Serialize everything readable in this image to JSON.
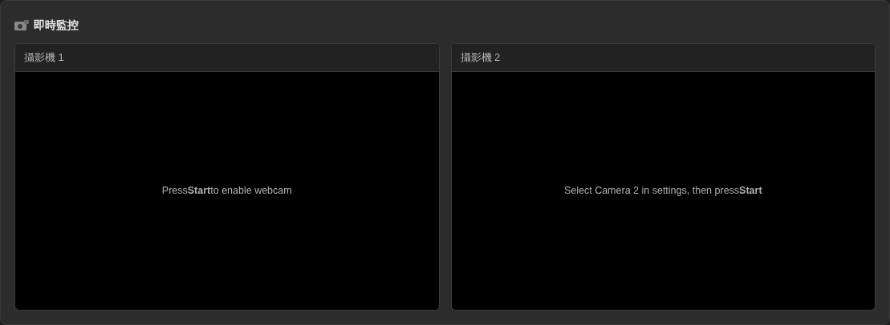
{
  "panel": {
    "title": "即時監控"
  },
  "cameras": [
    {
      "title": "攝影機 1",
      "message": "Press**Start**to enable webcam"
    },
    {
      "title": "攝影機 2",
      "message": "Select Camera 2 in settings, then press**Start**"
    }
  ]
}
